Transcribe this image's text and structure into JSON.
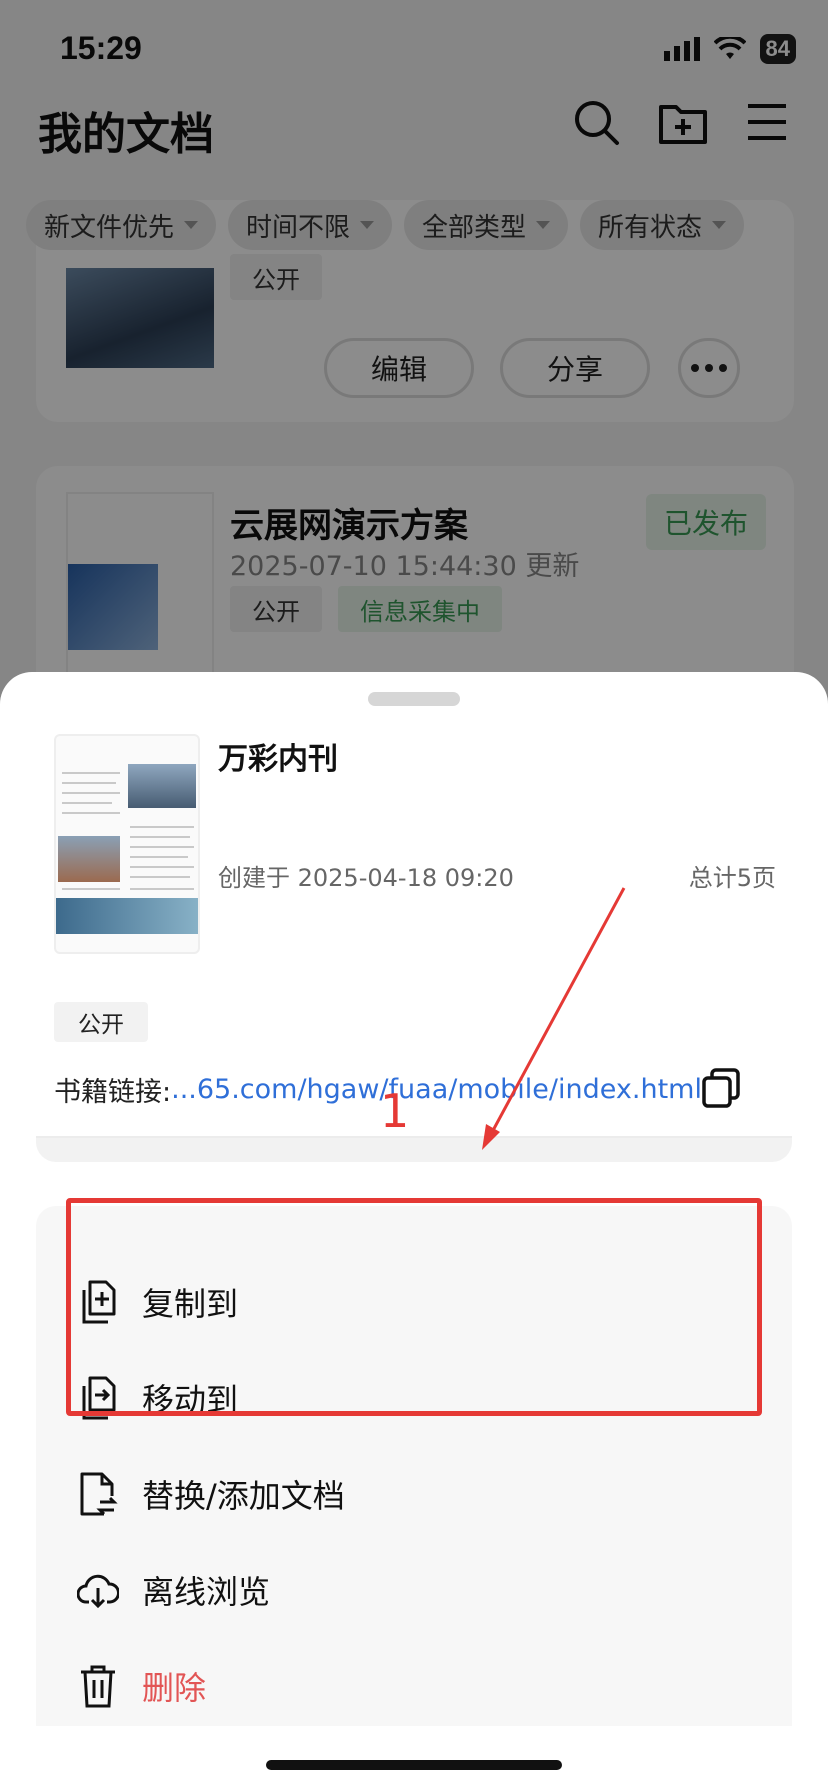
{
  "status_bar": {
    "time": "15:29",
    "battery": "84"
  },
  "header": {
    "title": "我的文档"
  },
  "filters": [
    {
      "label": "新文件优先"
    },
    {
      "label": "时间不限"
    },
    {
      "label": "全部类型"
    },
    {
      "label": "所有状态"
    }
  ],
  "background_cards": {
    "card1": {
      "visibility_tag": "公开",
      "edit_label": "编辑",
      "share_label": "分享"
    },
    "card2": {
      "title": "云展网演示方案",
      "updated": "2025-07-10 15:44:30 更新",
      "status": "已发布",
      "visibility_tag": "公开",
      "collect_tag": "信息采集中"
    }
  },
  "sheet": {
    "doc_title": "万彩内刊",
    "created": "创建于 2025-04-18 09:20",
    "pages": "总计5页",
    "visibility": "公开",
    "link_label": "书籍链接:",
    "link_url": "...65.com/hgaw/fuaa/mobile/index.html"
  },
  "menu": {
    "copy_to": "复制到",
    "move_to": "移动到",
    "replace_add": "替换/添加文档",
    "offline": "离线浏览",
    "delete": "删除"
  },
  "annotation": {
    "number": "1"
  },
  "colors": {
    "link": "#2f6fd8",
    "danger": "#e25555",
    "annotation": "#e53935",
    "status_green": "#3a9a55"
  }
}
